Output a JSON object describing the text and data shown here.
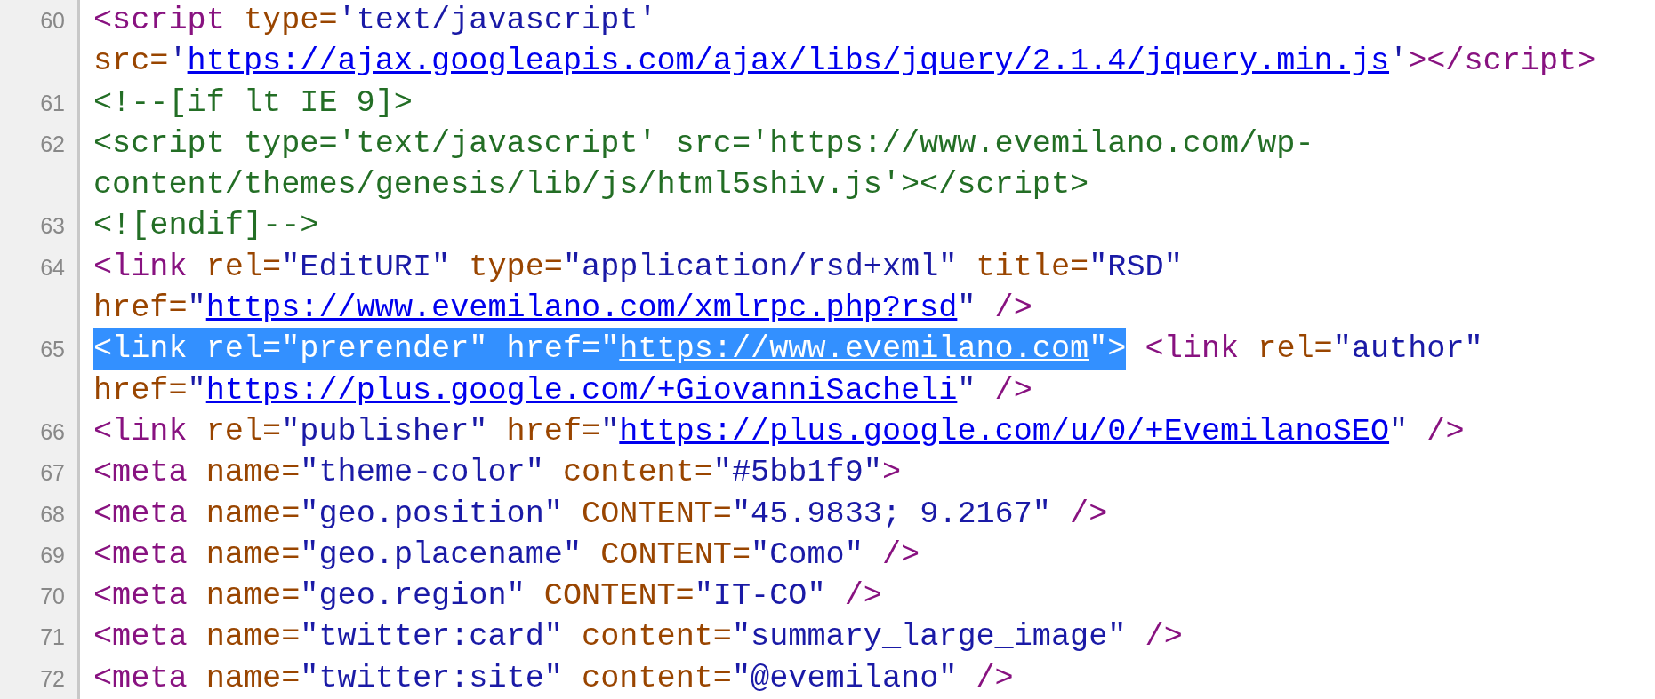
{
  "lines": [
    {
      "number": "60",
      "rows": [
        {
          "segments": [
            {
              "kind": "tag",
              "text": "<script ",
              "selected": false
            },
            {
              "kind": "attr",
              "text": "type=",
              "selected": false
            },
            {
              "kind": "value",
              "text": "'text/javascript'",
              "selected": false
            }
          ]
        },
        {
          "segments": [
            {
              "kind": "attr",
              "text": "src=",
              "selected": false
            },
            {
              "kind": "value",
              "text": "'",
              "selected": false
            },
            {
              "kind": "link",
              "text": "https://ajax.googleapis.com/ajax/libs/jquery/2.1.4/jquery.min.js",
              "selected": false
            },
            {
              "kind": "value",
              "text": "'",
              "selected": false
            },
            {
              "kind": "tag",
              "text": "></script>",
              "selected": false
            }
          ]
        }
      ]
    },
    {
      "number": "61",
      "rows": [
        {
          "segments": [
            {
              "kind": "comment",
              "text": "<!--[if lt IE 9]>",
              "selected": false
            }
          ]
        }
      ]
    },
    {
      "number": "62",
      "rows": [
        {
          "segments": [
            {
              "kind": "comment",
              "text": "<script type='text/javascript' src='https://www.evemilano.com/wp-",
              "selected": false
            }
          ]
        },
        {
          "segments": [
            {
              "kind": "comment",
              "text": "content/themes/genesis/lib/js/html5shiv.js'></script>",
              "selected": false
            }
          ]
        }
      ]
    },
    {
      "number": "63",
      "rows": [
        {
          "segments": [
            {
              "kind": "comment",
              "text": "<![endif]-->",
              "selected": false
            }
          ]
        }
      ]
    },
    {
      "number": "64",
      "rows": [
        {
          "segments": [
            {
              "kind": "tag",
              "text": "<link ",
              "selected": false
            },
            {
              "kind": "attr",
              "text": "rel=",
              "selected": false
            },
            {
              "kind": "value",
              "text": "\"EditURI\" ",
              "selected": false
            },
            {
              "kind": "attr",
              "text": "type=",
              "selected": false
            },
            {
              "kind": "value",
              "text": "\"application/rsd+xml\" ",
              "selected": false
            },
            {
              "kind": "attr",
              "text": "title=",
              "selected": false
            },
            {
              "kind": "value",
              "text": "\"RSD\"",
              "selected": false
            }
          ]
        },
        {
          "segments": [
            {
              "kind": "attr",
              "text": "href=",
              "selected": false
            },
            {
              "kind": "value",
              "text": "\"",
              "selected": false
            },
            {
              "kind": "link",
              "text": "https://www.evemilano.com/xmlrpc.php?rsd",
              "selected": false
            },
            {
              "kind": "value",
              "text": "\" ",
              "selected": false
            },
            {
              "kind": "tag",
              "text": "/>",
              "selected": false
            }
          ]
        }
      ]
    },
    {
      "number": "65",
      "rows": [
        {
          "segments": [
            {
              "kind": "tag",
              "text": "<link ",
              "selected": true
            },
            {
              "kind": "attr",
              "text": "rel=",
              "selected": true
            },
            {
              "kind": "value",
              "text": "\"prerender\" ",
              "selected": true
            },
            {
              "kind": "attr",
              "text": "href=",
              "selected": true
            },
            {
              "kind": "value",
              "text": "\"",
              "selected": true
            },
            {
              "kind": "link",
              "text": "https://www.evemilano.com",
              "selected": true
            },
            {
              "kind": "value",
              "text": "\"",
              "selected": true
            },
            {
              "kind": "tag",
              "text": ">",
              "selected": true
            },
            {
              "kind": "tag",
              "text": " <link ",
              "selected": false
            },
            {
              "kind": "attr",
              "text": "rel=",
              "selected": false
            },
            {
              "kind": "value",
              "text": "\"author\"",
              "selected": false
            }
          ]
        },
        {
          "segments": [
            {
              "kind": "attr",
              "text": "href=",
              "selected": false
            },
            {
              "kind": "value",
              "text": "\"",
              "selected": false
            },
            {
              "kind": "link",
              "text": "https://plus.google.com/+GiovanniSacheli",
              "selected": false
            },
            {
              "kind": "value",
              "text": "\" ",
              "selected": false
            },
            {
              "kind": "tag",
              "text": "/>",
              "selected": false
            }
          ]
        }
      ]
    },
    {
      "number": "66",
      "rows": [
        {
          "segments": [
            {
              "kind": "tag",
              "text": "<link ",
              "selected": false
            },
            {
              "kind": "attr",
              "text": "rel=",
              "selected": false
            },
            {
              "kind": "value",
              "text": "\"publisher\" ",
              "selected": false
            },
            {
              "kind": "attr",
              "text": "href=",
              "selected": false
            },
            {
              "kind": "value",
              "text": "\"",
              "selected": false
            },
            {
              "kind": "link",
              "text": "https://plus.google.com/u/0/+EvemilanoSEO",
              "selected": false
            },
            {
              "kind": "value",
              "text": "\" ",
              "selected": false
            },
            {
              "kind": "tag",
              "text": "/>",
              "selected": false
            }
          ]
        }
      ]
    },
    {
      "number": "67",
      "rows": [
        {
          "segments": [
            {
              "kind": "tag",
              "text": "<meta ",
              "selected": false
            },
            {
              "kind": "attr",
              "text": "name=",
              "selected": false
            },
            {
              "kind": "value",
              "text": "\"theme-color\" ",
              "selected": false
            },
            {
              "kind": "attr",
              "text": "content=",
              "selected": false
            },
            {
              "kind": "value",
              "text": "\"#5bb1f9\"",
              "selected": false
            },
            {
              "kind": "tag",
              "text": ">",
              "selected": false
            }
          ]
        }
      ]
    },
    {
      "number": "68",
      "rows": [
        {
          "segments": [
            {
              "kind": "tag",
              "text": "<meta ",
              "selected": false
            },
            {
              "kind": "attr",
              "text": "name=",
              "selected": false
            },
            {
              "kind": "value",
              "text": "\"geo.position\" ",
              "selected": false
            },
            {
              "kind": "attr",
              "text": "CONTENT=",
              "selected": false
            },
            {
              "kind": "value",
              "text": "\"45.9833; 9.2167\" ",
              "selected": false
            },
            {
              "kind": "tag",
              "text": "/>",
              "selected": false
            }
          ]
        }
      ]
    },
    {
      "number": "69",
      "rows": [
        {
          "segments": [
            {
              "kind": "tag",
              "text": "<meta ",
              "selected": false
            },
            {
              "kind": "attr",
              "text": "name=",
              "selected": false
            },
            {
              "kind": "value",
              "text": "\"geo.placename\" ",
              "selected": false
            },
            {
              "kind": "attr",
              "text": "CONTENT=",
              "selected": false
            },
            {
              "kind": "value",
              "text": "\"Como\" ",
              "selected": false
            },
            {
              "kind": "tag",
              "text": "/>",
              "selected": false
            }
          ]
        }
      ]
    },
    {
      "number": "70",
      "rows": [
        {
          "segments": [
            {
              "kind": "tag",
              "text": "<meta ",
              "selected": false
            },
            {
              "kind": "attr",
              "text": "name=",
              "selected": false
            },
            {
              "kind": "value",
              "text": "\"geo.region\" ",
              "selected": false
            },
            {
              "kind": "attr",
              "text": "CONTENT=",
              "selected": false
            },
            {
              "kind": "value",
              "text": "\"IT-CO\" ",
              "selected": false
            },
            {
              "kind": "tag",
              "text": "/>",
              "selected": false
            }
          ]
        }
      ]
    },
    {
      "number": "71",
      "rows": [
        {
          "segments": [
            {
              "kind": "tag",
              "text": "<meta ",
              "selected": false
            },
            {
              "kind": "attr",
              "text": "name=",
              "selected": false
            },
            {
              "kind": "value",
              "text": "\"twitter:card\" ",
              "selected": false
            },
            {
              "kind": "attr",
              "text": "content=",
              "selected": false
            },
            {
              "kind": "value",
              "text": "\"summary_large_image\" ",
              "selected": false
            },
            {
              "kind": "tag",
              "text": "/>",
              "selected": false
            }
          ]
        }
      ]
    },
    {
      "number": "72",
      "rows": [
        {
          "segments": [
            {
              "kind": "tag",
              "text": "<meta ",
              "selected": false
            },
            {
              "kind": "attr",
              "text": "name=",
              "selected": false
            },
            {
              "kind": "value",
              "text": "\"twitter:site\" ",
              "selected": false
            },
            {
              "kind": "attr",
              "text": "content=",
              "selected": false
            },
            {
              "kind": "value",
              "text": "\"@evemilano\" ",
              "selected": false
            },
            {
              "kind": "tag",
              "text": "/>",
              "selected": false
            }
          ]
        }
      ]
    }
  ]
}
